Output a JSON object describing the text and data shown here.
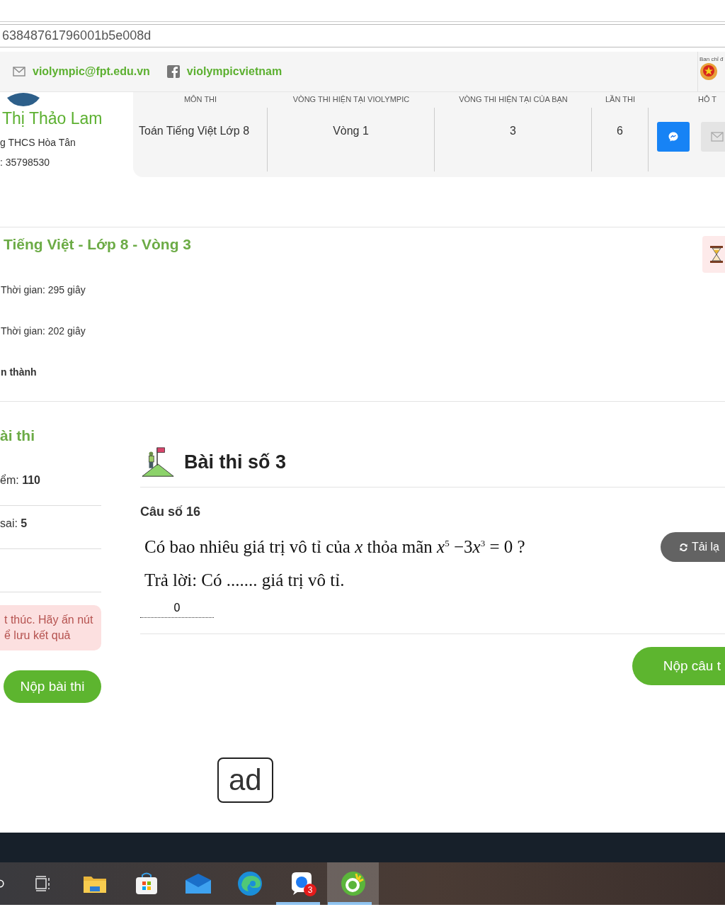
{
  "address_bar": {
    "value": "63848761796001b5e008d"
  },
  "header": {
    "email": "violympic@fpt.edu.vn",
    "facebook": "violympicvietnam",
    "agency": "Ban chỉ đ"
  },
  "profile": {
    "name": "Thị Thảo Lam",
    "school": "g THCS Hòa Tân",
    "id": ": 35798530"
  },
  "info_table": {
    "columns": [
      "MÔN THI",
      "VÒNG THI HIỆN TẠI VIOLYMPIC",
      "VÒNG THI HIỆN TẠI CỦA BẠN",
      "LẦN THI",
      "HỖ T"
    ],
    "row": [
      "Toán Tiếng Việt Lớp 8",
      "Vòng 1",
      "3",
      "6"
    ]
  },
  "round": {
    "title": "Tiếng Việt - Lớp 8 - Vòng 3",
    "lines": [
      {
        "text": "Thời gian: 295 giây",
        "bold": false
      },
      {
        "text": "Thời gian: 202 giây",
        "bold": false
      },
      {
        "text": "n thành",
        "bold": true
      }
    ]
  },
  "sidebar": {
    "title": "ài thi",
    "stats": [
      {
        "label": "ểm: ",
        "value": "110"
      },
      {
        "label": "sai: ",
        "value": "5"
      }
    ],
    "alert": "t thúc. Hãy ấn nút\nể lưu kết quả",
    "submit": "Nộp bài thi"
  },
  "exam": {
    "title": "Bài thi số 3",
    "question_label": "Câu số 16",
    "question": [
      {
        "kind": "plain",
        "text": "Có bao nhiêu giá trị vô tỉ của "
      },
      {
        "kind": "var",
        "text": "x"
      },
      {
        "kind": "plain",
        "text": " thỏa mãn "
      },
      {
        "kind": "var",
        "text": "x"
      },
      {
        "kind": "sup",
        "text": "5"
      },
      {
        "kind": "plain",
        "text": " −3"
      },
      {
        "kind": "var",
        "text": "x"
      },
      {
        "kind": "sup",
        "text": "3"
      },
      {
        "kind": "plain",
        "text": " = 0 ?"
      }
    ],
    "answer_prompt": "Trả lời:  Có ....... giá trị vô tỉ.",
    "answer_value": "0",
    "reload": "Tải lạ",
    "submit": "Nộp câu t"
  },
  "ad": "ad",
  "taskbar": {
    "apps": [
      {
        "kind": "search",
        "open": false,
        "selected": false
      },
      {
        "kind": "taskview",
        "open": false,
        "selected": false
      },
      {
        "kind": "files",
        "open": false,
        "selected": false
      },
      {
        "kind": "store",
        "open": false,
        "selected": false
      },
      {
        "kind": "mail",
        "open": false,
        "selected": false
      },
      {
        "kind": "edge",
        "open": false,
        "selected": false
      },
      {
        "kind": "chat",
        "open": true,
        "selected": false,
        "badge": "3"
      },
      {
        "kind": "browser",
        "open": true,
        "selected": true
      }
    ]
  }
}
